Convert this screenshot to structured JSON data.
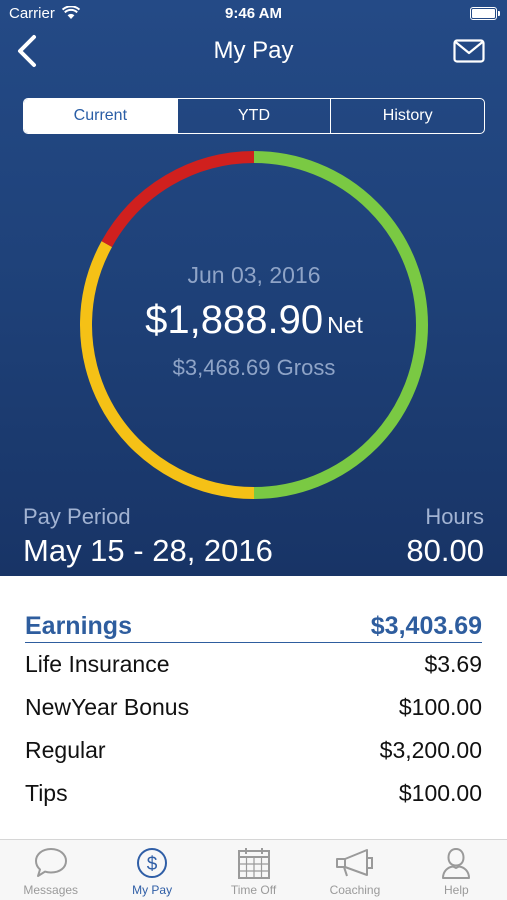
{
  "status_bar": {
    "carrier": "Carrier",
    "time": "9:46 AM"
  },
  "nav": {
    "title": "My Pay",
    "back_icon": "chevron-left-icon",
    "mail_icon": "envelope-icon"
  },
  "segments": [
    {
      "label": "Current",
      "active": true
    },
    {
      "label": "YTD",
      "active": false
    },
    {
      "label": "History",
      "active": false
    }
  ],
  "summary": {
    "date": "Jun 03, 2016",
    "net_amount": "$1,888.90",
    "net_label": "Net",
    "gross": "$3,468.69 Gross",
    "ring_segments": [
      {
        "color": "#7ac943",
        "fraction": 0.5
      },
      {
        "color": "#f5c116",
        "fraction": 0.33
      },
      {
        "color": "#d0201e",
        "fraction": 0.17
      }
    ]
  },
  "pay_period": {
    "label": "Pay Period",
    "value": "May 15 - 28, 2016"
  },
  "hours": {
    "label": "Hours",
    "value": "80.00"
  },
  "earnings": {
    "title": "Earnings",
    "total": "$3,403.69",
    "items": [
      {
        "name": "Life Insurance",
        "amount": "$3.69"
      },
      {
        "name": "NewYear Bonus",
        "amount": "$100.00"
      },
      {
        "name": "Regular",
        "amount": "$3,200.00"
      },
      {
        "name": "Tips",
        "amount": "$100.00"
      }
    ]
  },
  "tabs": [
    {
      "label": "Messages",
      "icon": "chat-bubble-icon",
      "active": false
    },
    {
      "label": "My Pay",
      "icon": "dollar-circle-icon",
      "active": true
    },
    {
      "label": "Time Off",
      "icon": "calendar-icon",
      "active": false
    },
    {
      "label": "Coaching",
      "icon": "megaphone-icon",
      "active": false
    },
    {
      "label": "Help",
      "icon": "person-icon",
      "active": false
    }
  ],
  "colors": {
    "header_bg": "#244a86",
    "accent": "#2e5d9e",
    "ring_green": "#7ac943",
    "ring_yellow": "#f5c116",
    "ring_red": "#d0201e"
  }
}
